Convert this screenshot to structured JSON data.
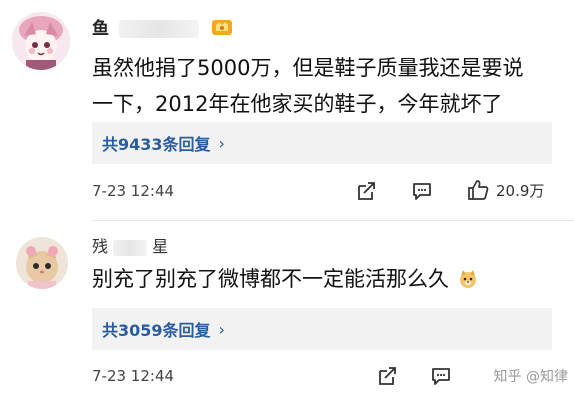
{
  "comments": [
    {
      "username": "鱼",
      "text_line1": "虽然他捐了5000万，但是鞋子质量我还是要说",
      "text_line2": "一下，2012年在他家买的鞋子，今年就坏了",
      "reply_label": "共9433条回复",
      "reply_chevron": "›",
      "time": "7-23 12:44",
      "likes": "20.9万"
    },
    {
      "username_part1": "残",
      "username_part2": "星",
      "text": "别充了别充了微博都不一定能活那么久",
      "reply_label": "共3059条回复",
      "reply_chevron": "›",
      "time": "7-23 12:44"
    }
  ],
  "watermark": "知乎 @知律"
}
